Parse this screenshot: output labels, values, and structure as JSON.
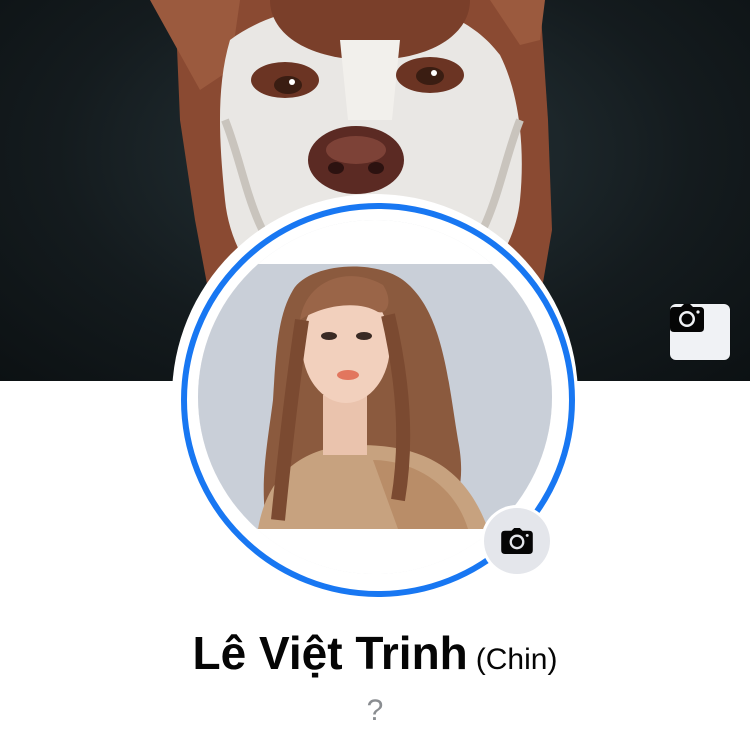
{
  "cover": {
    "camera_icon": "camera-icon"
  },
  "profile": {
    "camera_icon": "camera-icon",
    "ring_color": "#1877f2",
    "name": "Lê Việt Trinh",
    "alternate_name": "(Chin)",
    "bio": "?"
  },
  "colors": {
    "accent": "#1877f2",
    "icon_bg": "#e4e6eb",
    "muted_text": "#8a8d91"
  }
}
